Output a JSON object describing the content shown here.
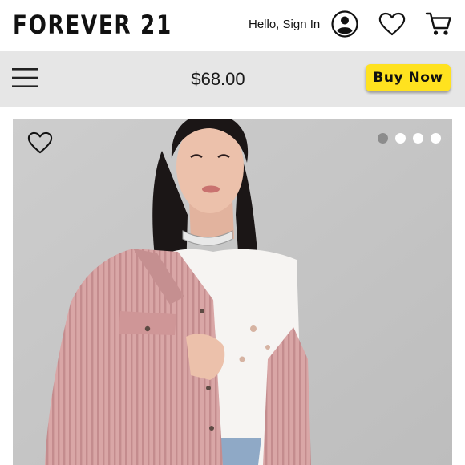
{
  "header": {
    "logo": "FOREVER 21",
    "greeting": "Hello, Sign In",
    "account_icon": "user-circle-icon",
    "wishlist_icon": "heart-icon",
    "cart_icon": "shopping-cart-icon"
  },
  "product_bar": {
    "menu_icon": "hamburger-menu-icon",
    "price": "$68.00",
    "buy_label": "Buy Now",
    "buy_color": "#ffe21f"
  },
  "gallery": {
    "favorite_icon": "heart-outline-icon",
    "image_count": 4,
    "active_index": 0,
    "background": "#c6c6c6"
  }
}
